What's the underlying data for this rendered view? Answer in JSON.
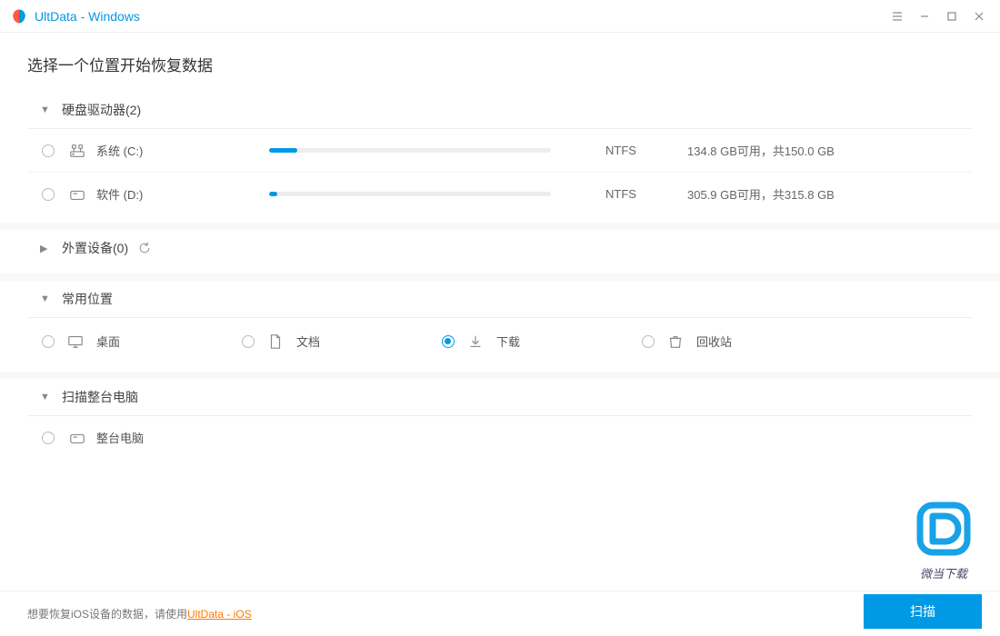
{
  "titlebar": {
    "title": "UltData - Windows"
  },
  "page_title": "选择一个位置开始恢复数据",
  "sections": {
    "drives": {
      "label": "硬盘驱动器(2)",
      "items": [
        {
          "name": "系统 (C:)",
          "fs": "NTFS",
          "space": "134.8 GB可用，共150.0 GB",
          "used_pct": 10
        },
        {
          "name": "软件 (D:)",
          "fs": "NTFS",
          "space": "305.9 GB可用，共315.8 GB",
          "used_pct": 3
        }
      ]
    },
    "external": {
      "label": "外置设备(0)"
    },
    "common": {
      "label": "常用位置",
      "items": [
        {
          "name": "桌面",
          "selected": false
        },
        {
          "name": "文档",
          "selected": false
        },
        {
          "name": "下载",
          "selected": true
        },
        {
          "name": "回收站",
          "selected": false
        }
      ]
    },
    "whole": {
      "label": "扫描整台电脑",
      "item": {
        "name": "整台电脑"
      }
    }
  },
  "footer": {
    "text": "想要恢复iOS设备的数据，请使用",
    "link": "UltData - iOS"
  },
  "scan_button": "扫描",
  "watermark": "微当下载"
}
